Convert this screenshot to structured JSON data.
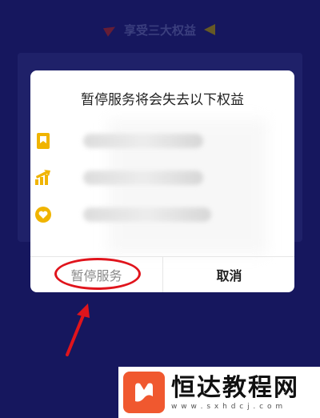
{
  "background": {
    "header_text": "享受三大权益",
    "background_color": "#16175e"
  },
  "dialog": {
    "title": "暂停服务将会失去以下权益",
    "benefits": [
      {
        "icon": "bookmark-icon",
        "text": ""
      },
      {
        "icon": "signal-bars-icon",
        "text": ""
      },
      {
        "icon": "heart-badge-icon",
        "text": ""
      }
    ],
    "pause_button": "暂停服务",
    "cancel_button": "取消",
    "accent_color": "#f0b400"
  },
  "annotation": {
    "color": "#e0141c"
  },
  "watermark": {
    "name": "恒达教程网",
    "url": "w w w . s x h d c j . c o m",
    "logo_color": "#f0582f"
  }
}
